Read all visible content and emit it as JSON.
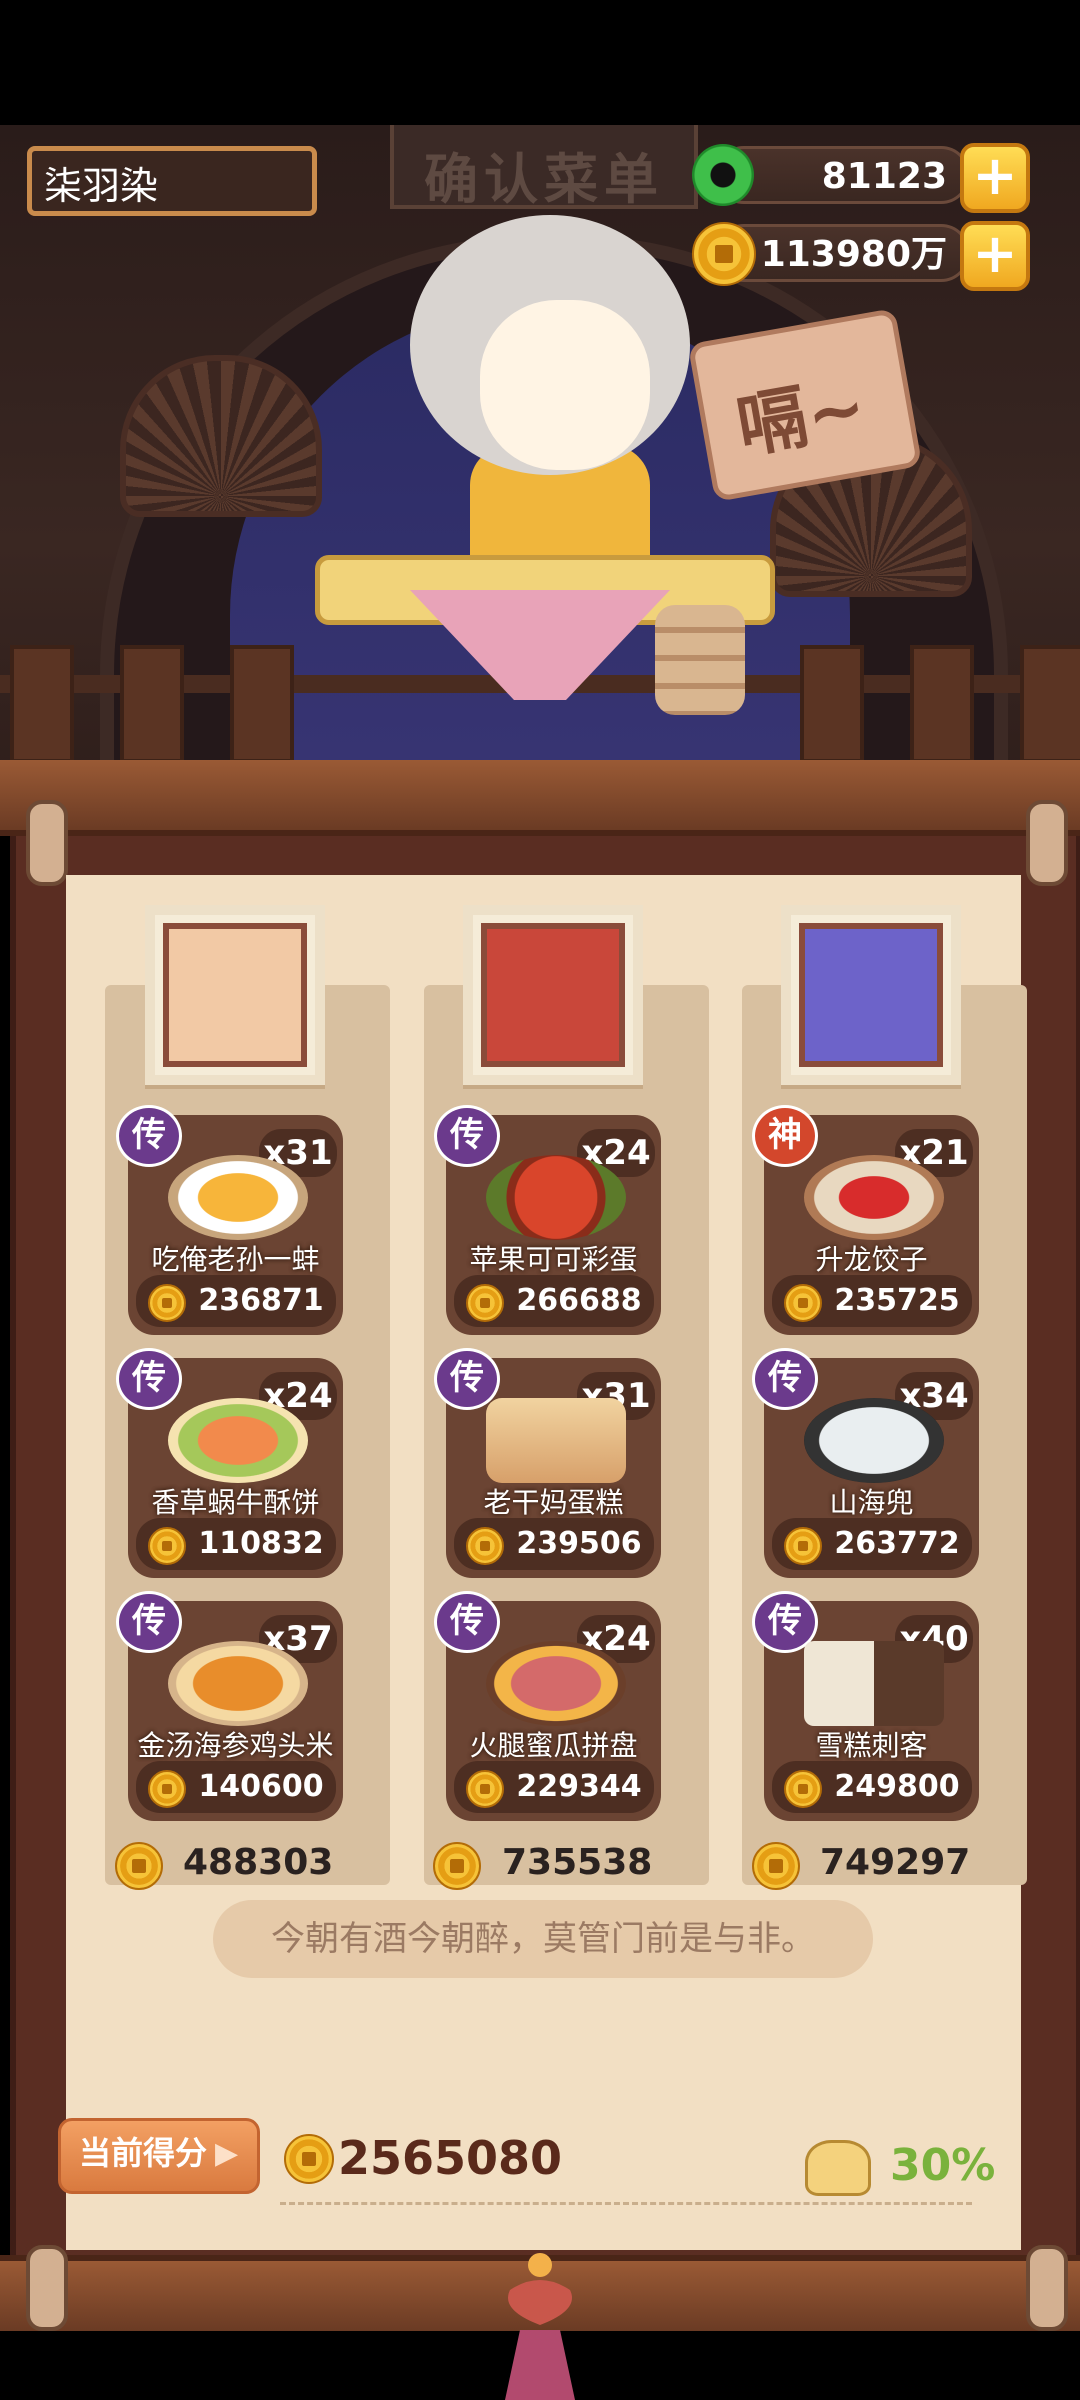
{
  "header": {
    "player_name": "柒羽染",
    "sign_title": "确认菜单",
    "jade_amount": "81123",
    "coin_amount": "113980万",
    "plus_symbol": "+"
  },
  "scene": {
    "wood_sign_text": "嗝~"
  },
  "columns": [
    {
      "total": "488303",
      "dishes": [
        {
          "rank": "传",
          "rank_type": "chuan",
          "count": "x31",
          "name": "吃俺老孙一蚌",
          "price": "236871"
        },
        {
          "rank": "传",
          "rank_type": "chuan",
          "count": "x24",
          "name": "香草蜗牛酥饼",
          "price": "110832"
        },
        {
          "rank": "传",
          "rank_type": "chuan",
          "count": "x37",
          "name": "金汤海参鸡头米",
          "price": "140600"
        }
      ]
    },
    {
      "total": "735538",
      "dishes": [
        {
          "rank": "传",
          "rank_type": "chuan",
          "count": "x24",
          "name": "苹果可可彩蛋",
          "price": "266688"
        },
        {
          "rank": "传",
          "rank_type": "chuan",
          "count": "x31",
          "name": "老干妈蛋糕",
          "price": "239506"
        },
        {
          "rank": "传",
          "rank_type": "chuan",
          "count": "x24",
          "name": "火腿蜜瓜拼盘",
          "price": "229344"
        }
      ]
    },
    {
      "total": "749297",
      "dishes": [
        {
          "rank": "神",
          "rank_type": "shen",
          "count": "x21",
          "name": "升龙饺子",
          "price": "235725"
        },
        {
          "rank": "传",
          "rank_type": "chuan",
          "count": "x34",
          "name": "山海兜",
          "price": "263772"
        },
        {
          "rank": "传",
          "rank_type": "chuan",
          "count": "x40",
          "name": "雪糕刺客",
          "price": "249800"
        }
      ]
    }
  ],
  "quote": "今朝有酒今朝醉，莫管门前是与非。",
  "score": {
    "label": "当前得分",
    "value": "2565080",
    "bonus": "30%"
  },
  "colors": {
    "rank_chuan": "#6b3a8c",
    "rank_shen": "#d3472c",
    "bonus_green": "#7ab23c"
  }
}
